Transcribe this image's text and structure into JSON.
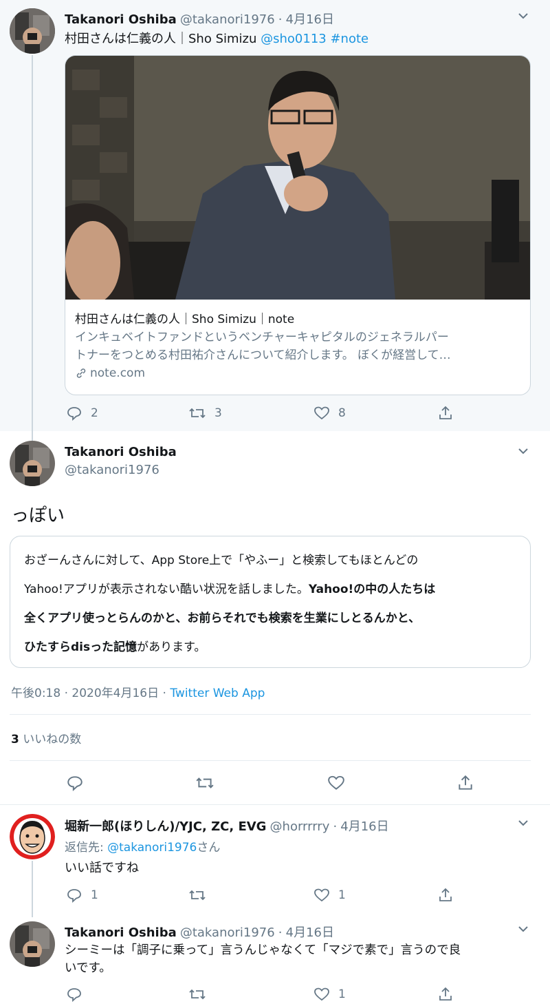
{
  "tweet1": {
    "name": "Takanori Oshiba",
    "handle": "@takanori1976",
    "date": "4月16日",
    "text": "村田さんは仁義の人｜Sho Simizu",
    "mention": "@sho0113",
    "hashtag": "#note",
    "card": {
      "title": "村田さんは仁義の人｜Sho Simizu｜note",
      "desc1": "インキュベイトファンドというベンチャーキャピタルのジェネラルパー",
      "desc2": "トナーをつとめる村田祐介さんについて紹介します。 ぼくが経営して…",
      "domain": "note.com"
    },
    "replies": "2",
    "retweets": "3",
    "likes": "8"
  },
  "main": {
    "name": "Takanori Oshiba",
    "handle": "@takanori1976",
    "text": "っぽい",
    "quote": {
      "l1": "おざーんさんに対して、App Store上で「やふー」と検索してもほとんどの",
      "l2a": "Yahoo!アプリが表示されない酷い状況を話しました。",
      "l2b": "Yahoo!の中の人たちは",
      "l3": "全くアプリ使っとらんのかと、お前らそれでも検索を生業にしとるんかと、",
      "l4a": "ひたすらdisった記憶",
      "l4b": "があります。"
    },
    "time": "午後0:18",
    "date": "2020年4月16日",
    "sep": "·",
    "app": "Twitter Web App",
    "like_count": "3",
    "like_label": "いいねの数"
  },
  "reply1": {
    "name": "堀新一郎(ほりしん)/YJC, ZC, EVG",
    "handle": "@horrrrry",
    "date": "4月16日",
    "reply_prefix": "返信先: ",
    "reply_to": "@takanori1976",
    "reply_suffix": "さん",
    "text": "いい話ですね",
    "replies": "1",
    "likes": "1"
  },
  "reply2": {
    "name": "Takanori Oshiba",
    "handle": "@takanori1976",
    "date": "4月16日",
    "text1": "シーミーは「調子に乗って」言うんじゃなくて「マジで素で」言うので良",
    "text2": "いです。",
    "likes": "1"
  },
  "dot": "·",
  "colors": {
    "link": "#1b95e0",
    "muted": "#657786",
    "thread_bg": "#f5f8fa",
    "border": "#e6ecf0"
  }
}
